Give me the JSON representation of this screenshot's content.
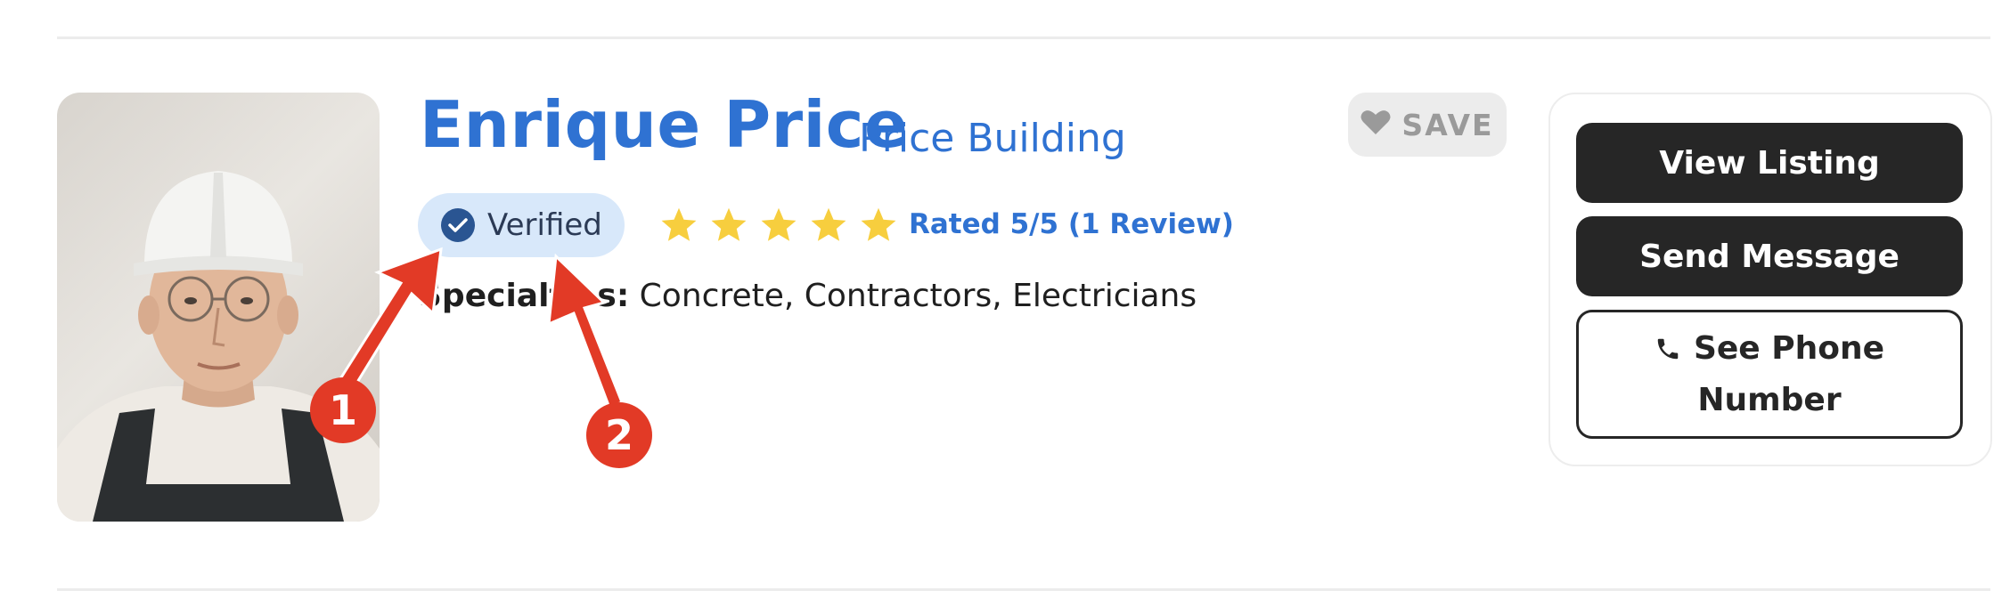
{
  "profile": {
    "name": "Enrique Price",
    "company": "Price Building",
    "verified_label": "Verified",
    "rating_text": "Rated 5/5 (1 Review)",
    "star_count": 5,
    "specialties_label": "Specialties:",
    "specialties_value": "Concrete, Contractors, Electricians"
  },
  "save": {
    "label": "SAVE"
  },
  "actions": {
    "view_listing": "View Listing",
    "send_message": "Send Message",
    "see_phone": "See Phone Number"
  },
  "annotations": {
    "marker_1": "1",
    "marker_2": "2"
  },
  "colors": {
    "brand_blue": "#2f72d2",
    "star_yellow": "#f7ce3e",
    "verified_bg": "#d8e8fa",
    "annotation_red": "#e23a26",
    "button_dark": "#262626"
  },
  "icons": [
    "heart-icon",
    "check-circle-icon",
    "star-icon",
    "phone-icon"
  ]
}
